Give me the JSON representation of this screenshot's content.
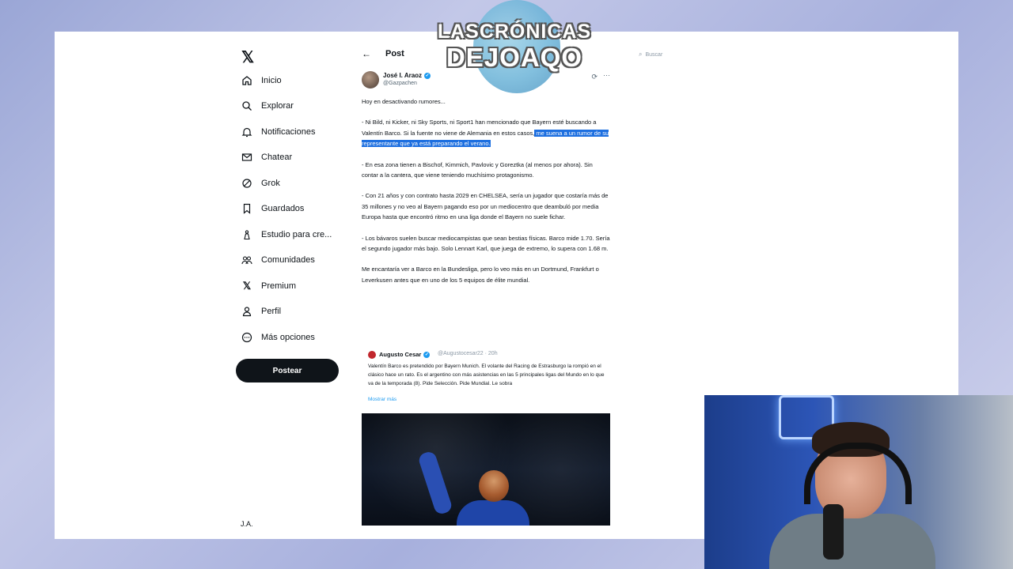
{
  "sidebar": {
    "logo": "𝕏",
    "items": [
      {
        "label": "Inicio",
        "icon": "home-icon",
        "glyph": "⌂"
      },
      {
        "label": "Explorar",
        "icon": "search-icon",
        "glyph": "⌕"
      },
      {
        "label": "Notificaciones",
        "icon": "bell-icon",
        "glyph": "🔔"
      },
      {
        "label": "Chatear",
        "icon": "mail-icon",
        "glyph": "✉"
      },
      {
        "label": "Grok",
        "icon": "grok-icon",
        "glyph": "⊘"
      },
      {
        "label": "Guardados",
        "icon": "bookmark-icon",
        "glyph": "🔖"
      },
      {
        "label": "Estudio para cre...",
        "icon": "studio-icon",
        "glyph": "♙"
      },
      {
        "label": "Comunidades",
        "icon": "communities-icon",
        "glyph": "⚇"
      },
      {
        "label": "Premium",
        "icon": "x-premium-icon",
        "glyph": "𝕏"
      },
      {
        "label": "Perfil",
        "icon": "profile-icon",
        "glyph": "♙"
      },
      {
        "label": "Más opciones",
        "icon": "more-options-icon",
        "glyph": "⋯"
      }
    ],
    "post_button": "Postear"
  },
  "header": {
    "back": "←",
    "title": "Post"
  },
  "search": {
    "placeholder": "Buscar"
  },
  "post": {
    "author_name": "José I. Araoz",
    "author_handle": "@Gazpachen",
    "paragraphs": {
      "p1": "Hoy en desactivando rumores...",
      "p2_a": "- Ni Bild, ni Kicker, ni Sky Sports, ni Sport1 han mencionado que Bayern esté buscando a Valentín Barco. Si la fuente no viene de Alemania en estos casos,",
      "p2_b": " me suena a un rumor de su representante que ya está preparando el verano.",
      "p3": "- En esa zona tienen a Bischof, Kimmich, Pavlovic y Goreztka (al menos por ahora). Sin contar a la cantera, que viene teniendo muchísimo protagonismo.",
      "p4": "- Con 21 años y con contrato hasta 2029 en CHELSEA, sería un jugador que costaría más de 35 millones y no veo al Bayern pagando eso por un mediocentro que deambuló por media Europa hasta que encontró ritmo en una liga donde el Bayern no suele fichar.",
      "p5": "- Los bávaros suelen buscar mediocampistas que sean bestias físicas. Barco mide 1.70. Sería el segundo jugador más bajo. Solo Lennart Karl, que juega de extremo, lo supera con 1.68 m.",
      "p6": "Me encantaría ver a Barco en la Bundesliga, pero lo veo más en un Dortmund, Frankfurt o Leverkusen antes que en uno de los 5 equipos de élite mundial."
    },
    "quote": {
      "name": "Augusto Cesar",
      "handle": "@Augustocesar22 · 20h",
      "text": "Valentín Barco es pretendido por Bayern Munich. El volante del Racing de Estrasburgo la rompió en el clásico hace un rato. Es el argentino con más asistencias en las 5 principales ligas del Mundo en lo que va de la temporada (8). Pide Selección. Pide Mundial. Le sobra",
      "more": "Mostrar más"
    }
  },
  "overlay": {
    "brand_line1": "LASCRÓNICAS",
    "brand_line2": "DEJOAQO"
  },
  "profile_stub": "J.A."
}
